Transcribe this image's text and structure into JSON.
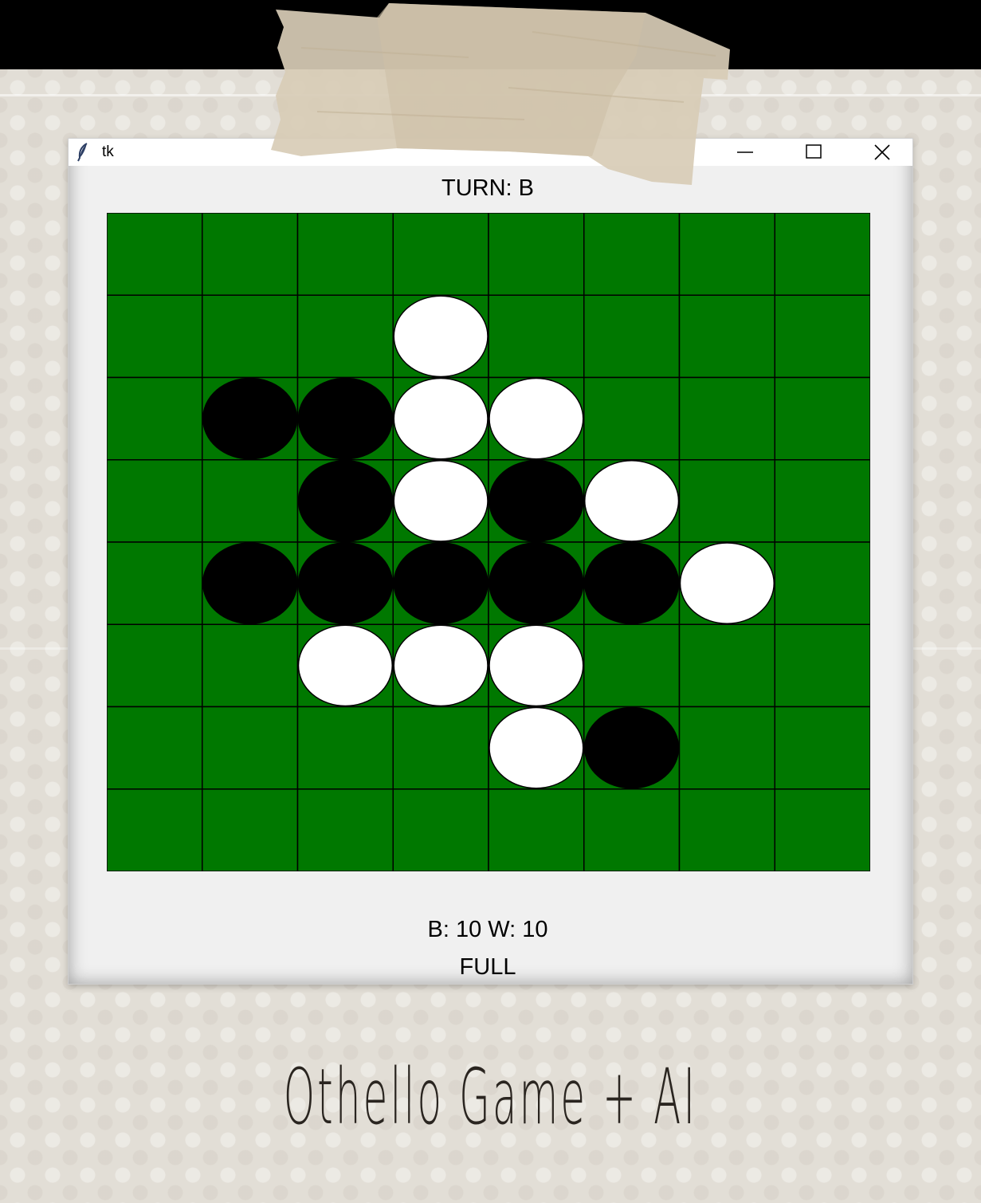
{
  "window": {
    "title": "tk"
  },
  "game": {
    "turn_text": "TURN: B",
    "score_text": "B: 10 W: 10",
    "mode_text": "FULL",
    "colors": {
      "board": "#007800",
      "grid": "#000000",
      "black": "#000000",
      "white": "#ffffff"
    },
    "board": [
      "........",
      "...W....",
      ".BBWW...",
      "..BWBW..",
      ".BBBBBW.",
      "..WWW...",
      "....WB..",
      "........"
    ]
  },
  "caption": {
    "text": "Othello Game + AI"
  },
  "icons": [
    "feather-icon",
    "minimize-icon",
    "maximize-icon",
    "close-icon"
  ]
}
